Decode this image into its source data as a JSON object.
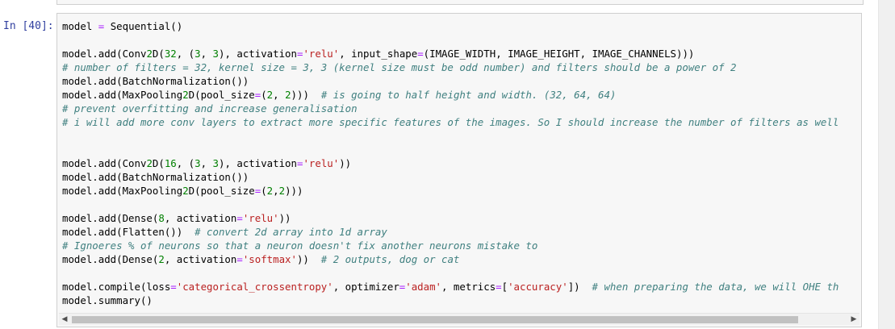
{
  "cell": {
    "prompt": "In [40]:",
    "lines": [
      "model = Sequential()",
      "",
      "model.add(Conv2D(32, (3, 3), activation='relu', input_shape=(IMAGE_WIDTH, IMAGE_HEIGHT, IMAGE_CHANNELS)))",
      "# number of filters = 32, kernel size = 3, 3 (kernel size must be odd number) and filters should be a power of 2",
      "model.add(BatchNormalization())",
      "model.add(MaxPooling2D(pool_size=(2, 2)))  # is going to half height and width. (32, 64, 64)",
      "# prevent overfitting and increase generalisation",
      "# i will add more conv layers to extract more specific features of the images. So I should increase the number of filters as well",
      "",
      "",
      "model.add(Conv2D(16, (3, 3), activation='relu'))",
      "model.add(BatchNormalization())",
      "model.add(MaxPooling2D(pool_size=(2,2)))",
      "",
      "model.add(Dense(8, activation='relu'))",
      "model.add(Flatten())  # convert 2d array into 1d array",
      "# Ignoeres % of neurons so that a neuron doesn't fix another neurons mistake to",
      "model.add(Dense(2, activation='softmax'))  # 2 outputs, dog or cat",
      "",
      "model.compile(loss='categorical_crossentropy', optimizer='adam', metrics=['accuracy'])  # when preparing the data, we will OHE th",
      "model.summary()"
    ]
  },
  "scrollbar": {
    "left_arrow_icon": "left-arrow-icon",
    "right_arrow_icon": "right-arrow-icon"
  }
}
